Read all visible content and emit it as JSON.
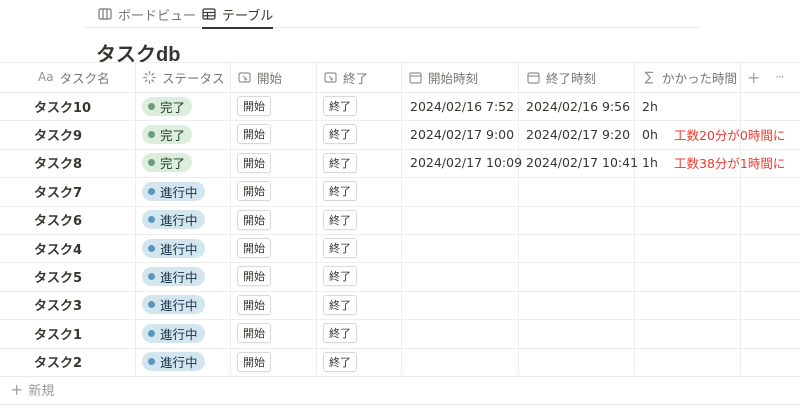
{
  "views": [
    {
      "label": "ボードビュー",
      "icon": "board-view-icon"
    },
    {
      "label": "テーブル",
      "icon": "table-view-icon"
    }
  ],
  "title": "タスクdb",
  "columns": [
    {
      "label": "タスク名",
      "icon_text": "Aa",
      "icon": "text-property-icon"
    },
    {
      "label": "ステータス",
      "icon": "status-property-icon"
    },
    {
      "label": "開始",
      "icon": "button-property-icon"
    },
    {
      "label": "終了",
      "icon": "button-property-icon"
    },
    {
      "label": "開始時刻",
      "icon": "calendar-property-icon"
    },
    {
      "label": "終了時刻",
      "icon": "calendar-property-icon"
    },
    {
      "label": "かかった時間",
      "icon_text": "∑",
      "icon": "formula-property-icon"
    }
  ],
  "add_column": "+",
  "more_options": "···",
  "rows": [
    {
      "name": "タスク10",
      "status": "完了",
      "start_btn": "開始",
      "end_btn": "終了",
      "start_time": "2024/02/16 7:52",
      "end_time": "2024/02/16 9:56",
      "duration": "2h",
      "note": ""
    },
    {
      "name": "タスク9",
      "status": "完了",
      "start_btn": "開始",
      "end_btn": "終了",
      "start_time": "2024/02/17 9:00",
      "end_time": "2024/02/17 9:20",
      "duration": "0h",
      "note": "工数20分が0時間に"
    },
    {
      "name": "タスク8",
      "status": "完了",
      "start_btn": "開始",
      "end_btn": "終了",
      "start_time": "2024/02/17 10:09",
      "end_time": "2024/02/17 10:41",
      "duration": "1h",
      "note": "工数38分が1時間に"
    },
    {
      "name": "タスク7",
      "status": "進行中",
      "start_btn": "開始",
      "end_btn": "終了",
      "start_time": "",
      "end_time": "",
      "duration": "",
      "note": ""
    },
    {
      "name": "タスク6",
      "status": "進行中",
      "start_btn": "開始",
      "end_btn": "終了",
      "start_time": "",
      "end_time": "",
      "duration": "",
      "note": ""
    },
    {
      "name": "タスク4",
      "status": "進行中",
      "start_btn": "開始",
      "end_btn": "終了",
      "start_time": "",
      "end_time": "",
      "duration": "",
      "note": ""
    },
    {
      "name": "タスク5",
      "status": "進行中",
      "start_btn": "開始",
      "end_btn": "終了",
      "start_time": "",
      "end_time": "",
      "duration": "",
      "note": ""
    },
    {
      "name": "タスク3",
      "status": "進行中",
      "start_btn": "開始",
      "end_btn": "終了",
      "start_time": "",
      "end_time": "",
      "duration": "",
      "note": ""
    },
    {
      "name": "タスク1",
      "status": "進行中",
      "start_btn": "開始",
      "end_btn": "終了",
      "start_time": "",
      "end_time": "",
      "duration": "",
      "note": ""
    },
    {
      "name": "タスク2",
      "status": "進行中",
      "start_btn": "開始",
      "end_btn": "終了",
      "start_time": "",
      "end_time": "",
      "duration": "",
      "note": ""
    }
  ],
  "new_row_label": "新規",
  "colors": {
    "done_bg": "#dbeddb",
    "done_dot": "#6c9b7d",
    "progress_bg": "#d3e5ef",
    "progress_dot": "#5b97bd",
    "note_red": "#eb3b2f"
  }
}
